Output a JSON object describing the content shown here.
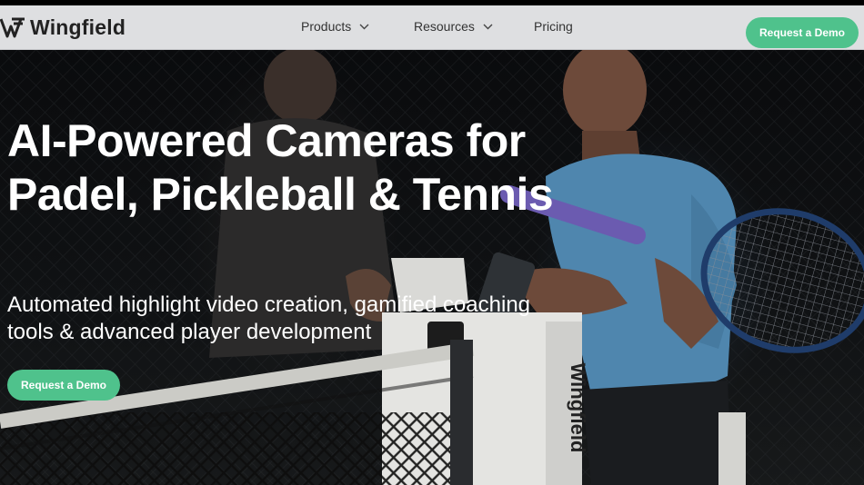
{
  "brand": {
    "name": "Wingfield",
    "accent_color": "#4fc28c",
    "logo_icon": "wingfield-w-logo-icon"
  },
  "nav": {
    "items": [
      {
        "label": "Products",
        "has_dropdown": true
      },
      {
        "label": "Resources",
        "has_dropdown": true
      },
      {
        "label": "Pricing",
        "has_dropdown": false
      }
    ],
    "cta_label": "Request a Demo"
  },
  "hero": {
    "headline": "AI-Powered Cameras for Padel, Pickleball & Tennis",
    "subheadline": "Automated highlight video creation, gamified coaching tools & advanced player development",
    "cta_label": "Request a Demo",
    "image": {
      "description_icon": "players-with-camera-photo",
      "camera_brand_text": "Wingfield"
    }
  }
}
